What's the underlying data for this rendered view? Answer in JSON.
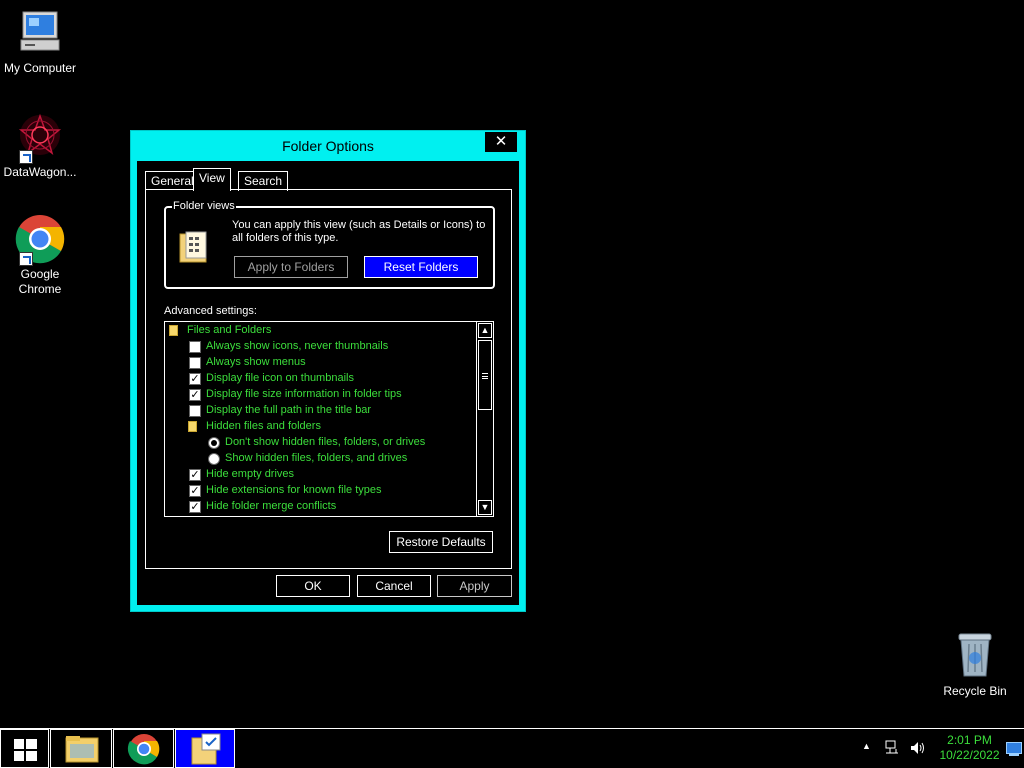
{
  "desktop": {
    "icons": [
      {
        "label": "My Computer",
        "icon": "computer-icon"
      },
      {
        "label": "DataWagon...",
        "icon": "datawagon-icon"
      },
      {
        "label": "Google Chrome",
        "icon": "chrome-icon"
      },
      {
        "label": "Recycle Bin",
        "icon": "recycle-bin-icon"
      }
    ]
  },
  "dialog": {
    "title": "Folder Options",
    "close_label": "✕",
    "tabs": [
      "General",
      "View",
      "Search"
    ],
    "active_tab": "View",
    "folder_views": {
      "legend": "Folder views",
      "description": "You can apply this view (such as Details or Icons) to all folders of this type.",
      "apply_button": "Apply to Folders",
      "reset_button": "Reset Folders"
    },
    "advanced_label": "Advanced settings:",
    "advanced_items": [
      {
        "type": "folder",
        "label": "Files and Folders",
        "indent": 0
      },
      {
        "type": "checkbox",
        "label": "Always show icons, never thumbnails",
        "checked": false,
        "indent": 1
      },
      {
        "type": "checkbox",
        "label": "Always show menus",
        "checked": false,
        "indent": 1
      },
      {
        "type": "checkbox",
        "label": "Display file icon on thumbnails",
        "checked": true,
        "indent": 1
      },
      {
        "type": "checkbox",
        "label": "Display file size information in folder tips",
        "checked": true,
        "indent": 1
      },
      {
        "type": "checkbox",
        "label": "Display the full path in the title bar",
        "checked": false,
        "indent": 1
      },
      {
        "type": "folder",
        "label": "Hidden files and folders",
        "indent": 1
      },
      {
        "type": "radio",
        "label": "Don't show hidden files, folders, or drives",
        "checked": true,
        "indent": 2
      },
      {
        "type": "radio",
        "label": "Show hidden files, folders, and drives",
        "checked": false,
        "indent": 2
      },
      {
        "type": "checkbox",
        "label": "Hide empty drives",
        "checked": true,
        "indent": 1
      },
      {
        "type": "checkbox",
        "label": "Hide extensions for known file types",
        "checked": true,
        "indent": 1
      },
      {
        "type": "checkbox",
        "label": "Hide folder merge conflicts",
        "checked": true,
        "indent": 1
      }
    ],
    "restore_button": "Restore Defaults",
    "ok_button": "OK",
    "cancel_button": "Cancel",
    "apply_button": "Apply",
    "text_color": "#3cde3c",
    "frame_color": "#00f0f0"
  },
  "taskbar": {
    "clock_time": "2:01 PM",
    "clock_date": "10/22/2022",
    "items": [
      "start-icon",
      "file-explorer-icon",
      "chrome-icon",
      "folder-options-icon"
    ]
  }
}
